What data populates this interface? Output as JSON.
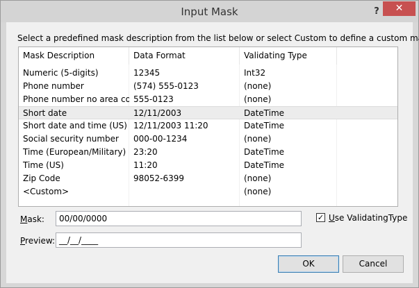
{
  "window": {
    "title": "Input Mask",
    "help_glyph": "?",
    "close_glyph": "✕"
  },
  "instruction": "Select a predefined mask description from the list below or select Custom to define a custom mask.",
  "columns": [
    "Mask Description",
    "Data Format",
    "Validating Type"
  ],
  "rows": [
    [
      "Numeric (5-digits)",
      "12345",
      "Int32"
    ],
    [
      "Phone number",
      "(574) 555-0123",
      "(none)"
    ],
    [
      "Phone number no area co...",
      "555-0123",
      "(none)"
    ],
    [
      "Short date",
      "12/11/2003",
      "DateTime"
    ],
    [
      "Short date and time (US)",
      "12/11/2003 11:20",
      "DateTime"
    ],
    [
      "Social security number",
      "000-00-1234",
      "(none)"
    ],
    [
      "Time (European/Military)",
      "23:20",
      "DateTime"
    ],
    [
      "Time (US)",
      "11:20",
      "DateTime"
    ],
    [
      "Zip Code",
      "98052-6399",
      "(none)"
    ],
    [
      "<Custom>",
      "",
      "(none)"
    ]
  ],
  "selected_row": 3,
  "mask": {
    "label_key": "M",
    "label_rest": "ask:",
    "value": "00/00/0000"
  },
  "preview": {
    "label_key": "P",
    "label_rest": "review:",
    "value": "__/__/____"
  },
  "use_validating_type": {
    "checked": true,
    "label_key": "U",
    "label_rest": "se ValidatingType",
    "check_glyph": "✓"
  },
  "buttons": {
    "ok": "OK",
    "cancel": "Cancel"
  }
}
